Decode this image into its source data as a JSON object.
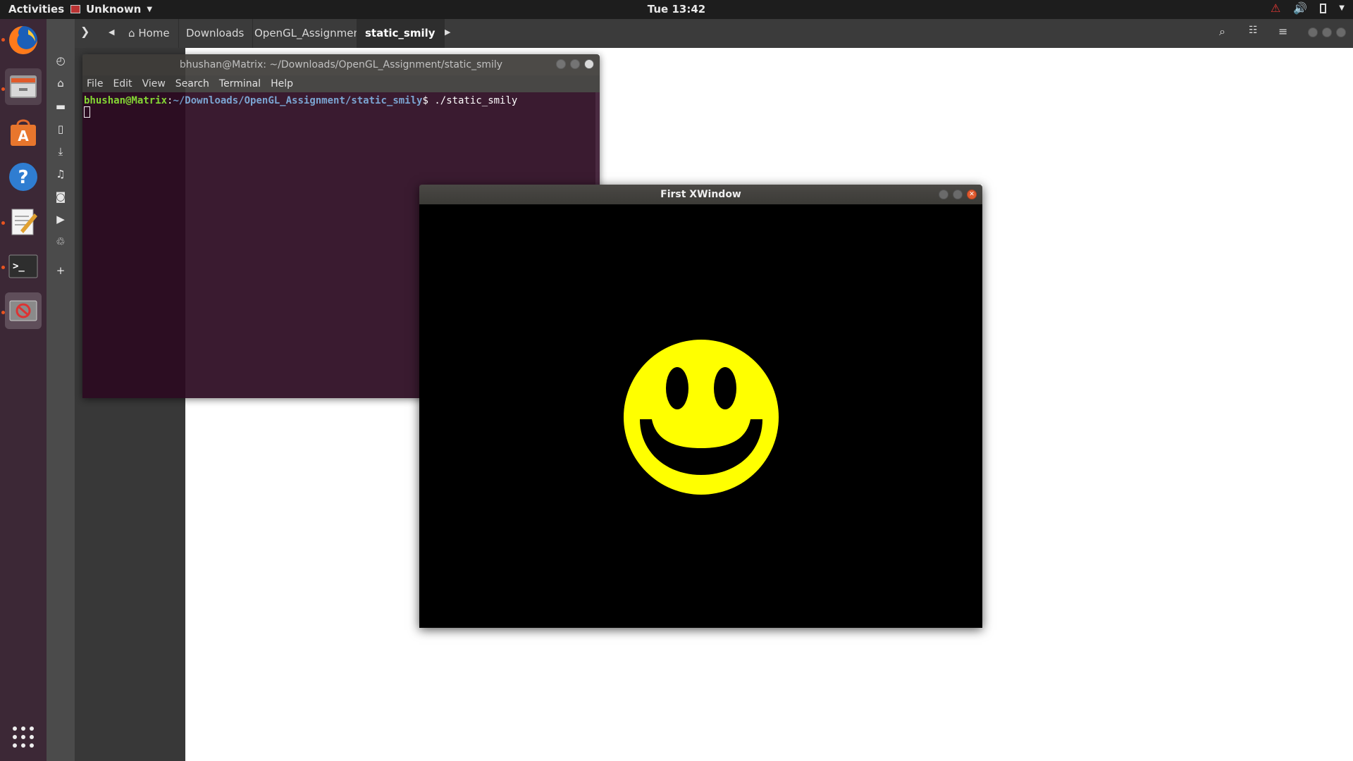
{
  "top_bar": {
    "activities": "Activities",
    "app_menu": "Unknown",
    "clock": "Tue 13:42",
    "tray_icons": [
      "warning-icon",
      "volume-icon",
      "battery-icon",
      "power-menu-icon"
    ]
  },
  "dock": {
    "items": [
      "firefox",
      "files",
      "ubuntu-software",
      "help",
      "text-editor",
      "terminal",
      "unknown-app"
    ],
    "show_apps_icon": "show-applications-icon"
  },
  "nautilus": {
    "breadcrumbs": [
      "Home",
      "Downloads",
      "OpenGL_Assignment",
      "static_smily"
    ],
    "active_crumb": "static_smily",
    "sidebar_icons": [
      "recent-icon",
      "home-icon",
      "folder-icon",
      "document-icon",
      "download-icon",
      "music-icon",
      "camera-icon",
      "video-icon",
      "trash-icon",
      "plus-icon"
    ]
  },
  "terminal": {
    "title": "bhushan@Matrix: ~/Downloads/OpenGL_Assignment/static_smily",
    "menu": [
      "File",
      "Edit",
      "View",
      "Search",
      "Terminal",
      "Help"
    ],
    "prompt_user": "bhushan@Matrix",
    "prompt_sep": ":",
    "prompt_path": "~/Downloads/OpenGL_Assignment/static_smily",
    "prompt_symbol": "$",
    "command": " ./static_smily"
  },
  "xwindow": {
    "title": "First XWindow",
    "face_color": "#ffff00",
    "background_color": "#000000"
  },
  "colors": {
    "dock_bg": "#3c2836",
    "terminal_bg": "#2c0a21",
    "accent": "#e95420"
  }
}
